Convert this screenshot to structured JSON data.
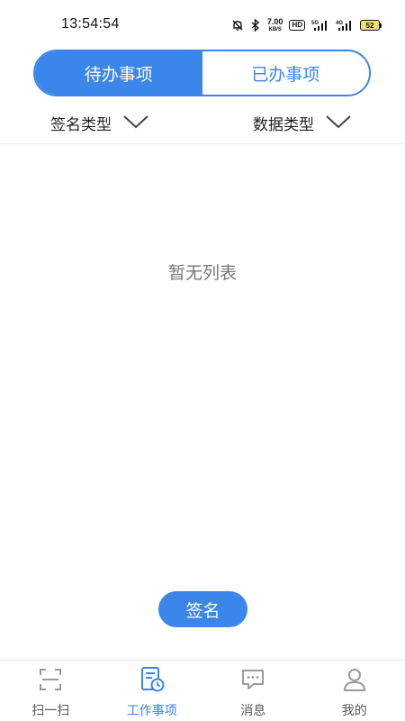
{
  "status_bar": {
    "time": "13:54:54",
    "network_speed_value": "7.00",
    "network_speed_unit": "KB/S",
    "hd_badge": "HD",
    "battery_level": "52",
    "icons": [
      "mute-bell-icon",
      "bluetooth-icon",
      "hd-icon",
      "5g-signal-icon",
      "4g-signal-icon",
      "battery-icon"
    ]
  },
  "tabs": {
    "pending": "待办事项",
    "done": "已办事项",
    "active": "pending"
  },
  "filters": {
    "sign_type": "签名类型",
    "data_type": "数据类型"
  },
  "empty_state": "暂无列表",
  "sign_button": "签名",
  "bottom_nav": {
    "items": [
      {
        "label": "扫一扫",
        "icon": "scan-icon",
        "active": false
      },
      {
        "label": "工作事项",
        "icon": "work-items-icon",
        "active": true
      },
      {
        "label": "消息",
        "icon": "message-icon",
        "active": false
      },
      {
        "label": "我的",
        "icon": "profile-icon",
        "active": false
      }
    ]
  },
  "colors": {
    "accent": "#3a86ea",
    "inactive_icon": "#9a9a9a",
    "battery_fill": "#f0e07a"
  }
}
